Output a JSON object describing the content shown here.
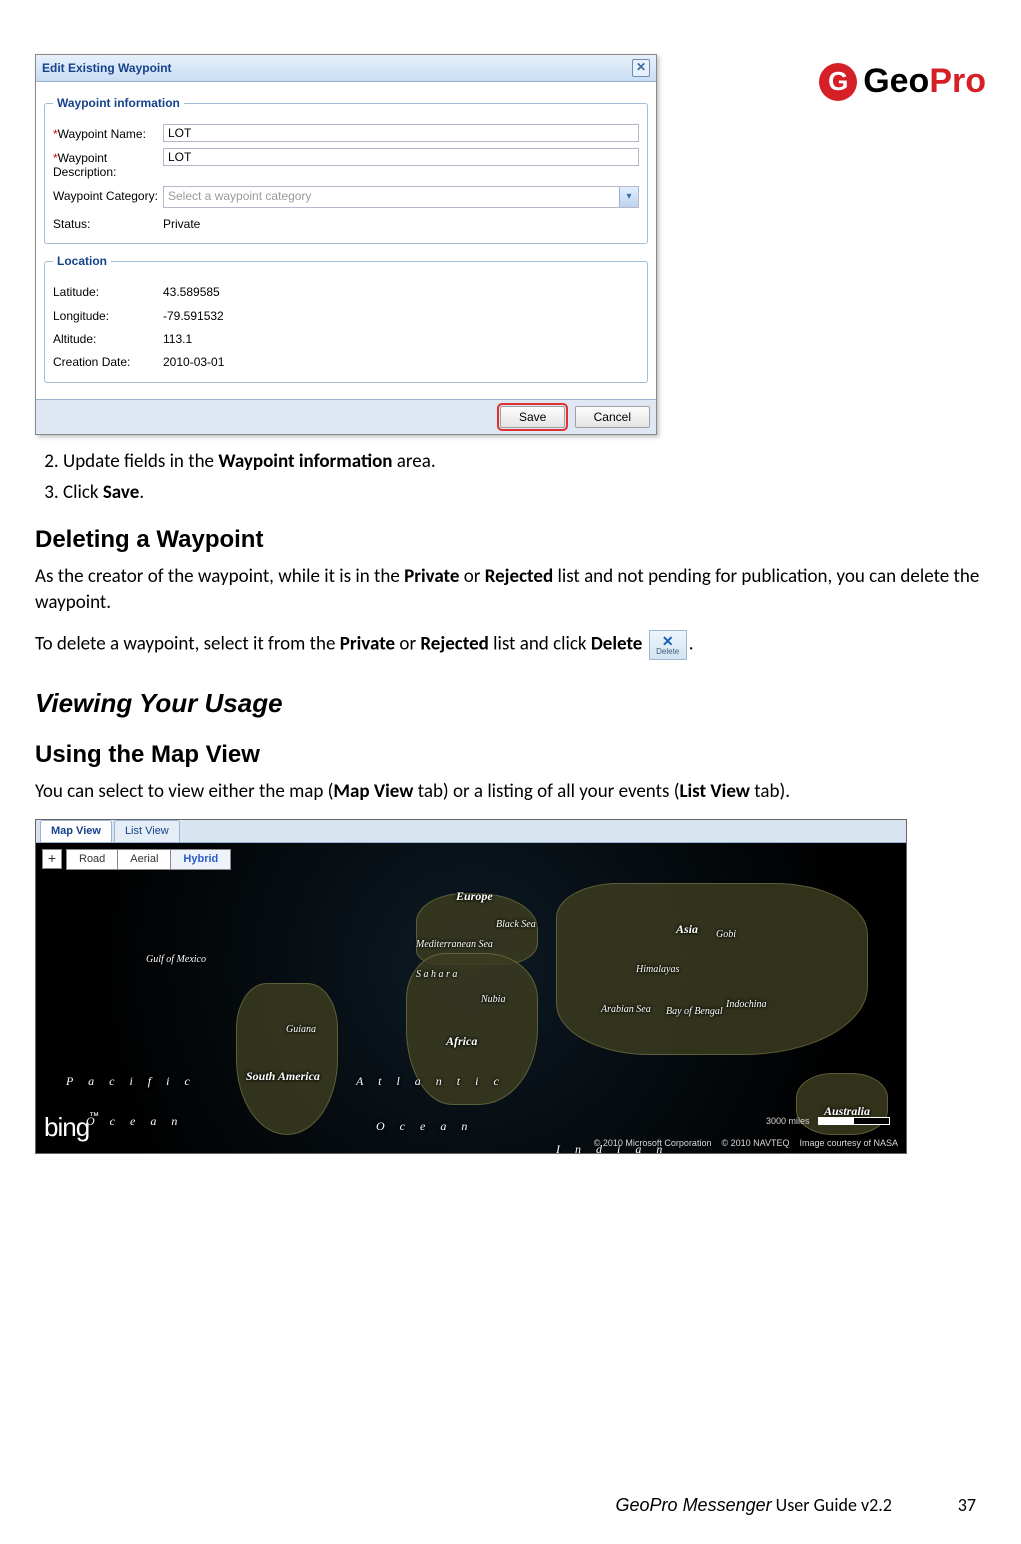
{
  "brand": {
    "name_part1": "Geo",
    "name_part2": "Pro",
    "mark": "G"
  },
  "dialog": {
    "title": "Edit Existing Waypoint",
    "groups": {
      "info": {
        "legend": "Waypoint information",
        "name_label": "Waypoint Name:",
        "name_value": "LOT",
        "desc_label": "Waypoint Description:",
        "desc_value": "LOT",
        "cat_label": "Waypoint Category:",
        "cat_placeholder": "Select a waypoint category",
        "status_label": "Status:",
        "status_value": "Private"
      },
      "loc": {
        "legend": "Location",
        "lat_label": "Latitude:",
        "lat_value": "43.589585",
        "lon_label": "Longitude:",
        "lon_value": "-79.591532",
        "alt_label": "Altitude:",
        "alt_value": "113.1",
        "date_label": "Creation Date:",
        "date_value": "2010-03-01"
      }
    },
    "save": "Save",
    "cancel": "Cancel"
  },
  "steps": {
    "s2_a": "Update fields in the ",
    "s2_b": "Waypoint information",
    "s2_c": " area.",
    "s3_a": "Click ",
    "s3_b": "Save",
    "s3_c": "."
  },
  "headings": {
    "delete": "Deleting a Waypoint",
    "viewing": "Viewing Your Usage",
    "mapview": "Using the Map View"
  },
  "paras": {
    "del_1a": "As the creator of the waypoint, while it is in the ",
    "del_1b": "Private",
    "del_1c": " or ",
    "del_1d": "Rejected",
    "del_1e": " list and not pending for publication, you can delete the waypoint.",
    "del_2a": "To delete a waypoint, select it from the ",
    "del_2b": "Private",
    "del_2c": " or ",
    "del_2d": "Rejected",
    "del_2e": " list and click ",
    "del_2f": "Delete",
    "del_2g": ".",
    "map_1a": "You can select to view either the map (",
    "map_1b": "Map View",
    "map_1c": " tab) or a listing of all your events (",
    "map_1d": "List View",
    "map_1e": " tab)."
  },
  "delete_chip": {
    "x": "✕",
    "label": "Delete"
  },
  "map": {
    "tabs": {
      "map": "Map View",
      "list": "List View"
    },
    "layers": {
      "road": "Road",
      "aerial": "Aerial",
      "hybrid": "Hybrid"
    },
    "labels": {
      "europe": "Europe",
      "asia": "Asia",
      "africa": "Africa",
      "sa": "South America",
      "aus": "Australia",
      "med": "Mediterranean Sea",
      "black": "Black Sea",
      "arabian": "Arabian Sea",
      "bengal": "Bay of Bengal",
      "indochina": "Indochina",
      "himalayas": "Himalayas",
      "gobi": "Gobi",
      "nubia": "Nubia",
      "sahara": "S a h a r a",
      "guiana": "Guiana",
      "gulfmex": "Gulf of Mexico",
      "pacific": "P a c i f i c",
      "atlantic": "A t l a n t i c",
      "ocean1": "O c e a n",
      "ocean2": "O c e a n",
      "indian": "I n d i a n"
    },
    "scale": "3000 miles",
    "bing": "bing",
    "attrib1": "© 2010 Microsoft Corporation",
    "attrib2": "© 2010 NAVTEQ",
    "attrib3": "Image courtesy of NASA"
  },
  "footer": {
    "doc": "GeoPro Messenger",
    "ver": " User Guide v2.2",
    "page": "37"
  }
}
